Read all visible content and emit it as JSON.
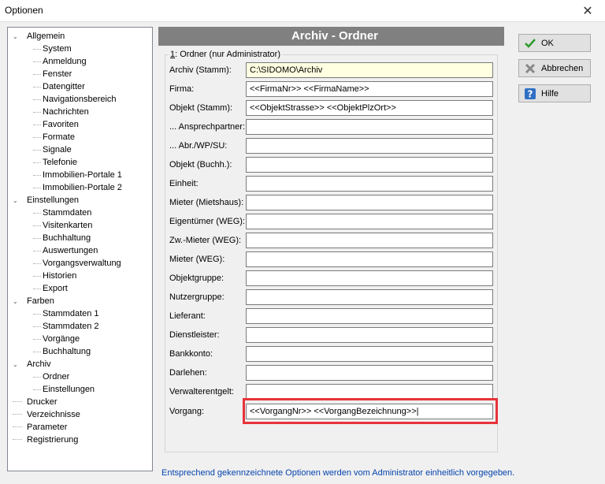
{
  "window": {
    "title": "Optionen"
  },
  "tree": [
    {
      "label": "Allgemein",
      "level": 0,
      "expandable": true
    },
    {
      "label": "System",
      "level": 1
    },
    {
      "label": "Anmeldung",
      "level": 1
    },
    {
      "label": "Fenster",
      "level": 1
    },
    {
      "label": "Datengitter",
      "level": 1
    },
    {
      "label": "Navigationsbereich",
      "level": 1
    },
    {
      "label": "Nachrichten",
      "level": 1
    },
    {
      "label": "Favoriten",
      "level": 1
    },
    {
      "label": "Formate",
      "level": 1
    },
    {
      "label": "Signale",
      "level": 1
    },
    {
      "label": "Telefonie",
      "level": 1
    },
    {
      "label": "Immobilien-Portale 1",
      "level": 1
    },
    {
      "label": "Immobilien-Portale 2",
      "level": 1
    },
    {
      "label": "Einstellungen",
      "level": 0,
      "expandable": true
    },
    {
      "label": "Stammdaten",
      "level": 1
    },
    {
      "label": "Visitenkarten",
      "level": 1
    },
    {
      "label": "Buchhaltung",
      "level": 1
    },
    {
      "label": "Auswertungen",
      "level": 1
    },
    {
      "label": "Vorgangsverwaltung",
      "level": 1
    },
    {
      "label": "Historien",
      "level": 1
    },
    {
      "label": "Export",
      "level": 1
    },
    {
      "label": "Farben",
      "level": 0,
      "expandable": true
    },
    {
      "label": "Stammdaten 1",
      "level": 1
    },
    {
      "label": "Stammdaten 2",
      "level": 1
    },
    {
      "label": "Vorgänge",
      "level": 1
    },
    {
      "label": "Buchhaltung",
      "level": 1
    },
    {
      "label": "Archiv",
      "level": 0,
      "expandable": true
    },
    {
      "label": "Ordner",
      "level": 1
    },
    {
      "label": "Einstellungen",
      "level": 1
    },
    {
      "label": "Drucker",
      "level": 0
    },
    {
      "label": "Verzeichnisse",
      "level": 0
    },
    {
      "label": "Parameter",
      "level": 0
    },
    {
      "label": "Registrierung",
      "level": 0
    }
  ],
  "panel": {
    "header": "Archiv - Ordner",
    "group_prefix": "1",
    "group_label": ": Ordner  (nur Administrator)"
  },
  "fields": [
    {
      "label": "Archiv (Stamm):",
      "value": "C:\\SIDOMO\\Archiv",
      "highlight": "yellow"
    },
    {
      "label": "Firma:",
      "value": "<<FirmaNr>> <<FirmaName>>"
    },
    {
      "label": "Objekt (Stamm):",
      "value": "<<ObjektStrasse>> <<ObjektPlzOrt>>"
    },
    {
      "label": "... Ansprechpartner:",
      "value": ""
    },
    {
      "label": "... Abr./WP/SU:",
      "value": ""
    },
    {
      "label": "Objekt (Buchh.):",
      "value": ""
    },
    {
      "label": "Einheit:",
      "value": ""
    },
    {
      "label": "Mieter (Mietshaus):",
      "value": ""
    },
    {
      "label": "Eigentümer (WEG):",
      "value": ""
    },
    {
      "label": "Zw.-Mieter (WEG):",
      "value": ""
    },
    {
      "label": "Mieter (WEG):",
      "value": ""
    },
    {
      "label": "Objektgruppe:",
      "value": ""
    },
    {
      "label": "Nutzergruppe:",
      "value": ""
    },
    {
      "label": "Lieferant:",
      "value": ""
    },
    {
      "label": "Dienstleister:",
      "value": ""
    },
    {
      "label": "Bankkonto:",
      "value": ""
    },
    {
      "label": "Darlehen:",
      "value": ""
    },
    {
      "label": "Verwalterentgelt:",
      "value": ""
    },
    {
      "label": "Vorgang:",
      "value": "<<VorgangNr>> <<VorgangBezeichnung>>|"
    }
  ],
  "buttons": {
    "ok": "OK",
    "cancel": "Abbrechen",
    "help": "Hilfe"
  },
  "footer": "Entsprechend gekennzeichnete Optionen werden vom Administrator einheitlich vorgegeben.",
  "colors": {
    "highlight_border": "#e8333a",
    "header_bg": "#808080",
    "footer_text": "#0645ad"
  }
}
